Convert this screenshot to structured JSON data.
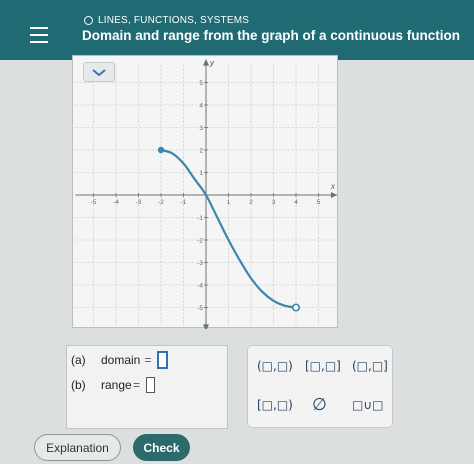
{
  "header": {
    "topic": "LINES, FUNCTIONS, SYSTEMS",
    "title": "Domain and range from the graph of a continuous function"
  },
  "graph": {
    "y_label": "y",
    "x_label": "x",
    "x_ticks": [
      "-5",
      "-4",
      "-3",
      "-2",
      "-1",
      "1",
      "2",
      "3",
      "4",
      "5"
    ],
    "y_ticks": [
      "5",
      "4",
      "3",
      "2",
      "1",
      "-1",
      "-2",
      "-3",
      "-4",
      "-5"
    ],
    "start_point": {
      "x": -2,
      "y": 2,
      "closed": true
    },
    "end_point": {
      "x": 4,
      "y": -5,
      "closed": false
    }
  },
  "answers": {
    "domain": {
      "part": "(a)",
      "label": "domain",
      "eq": "="
    },
    "range": {
      "part": "(b)",
      "label": "range",
      "eq": "="
    }
  },
  "palette": {
    "open_open": "(□,□)",
    "closed_closed": "[□,□]",
    "open_closed": "(□,□]",
    "closed_open": "[□,□)",
    "empty_set": "∅",
    "union": "□∪□"
  },
  "footer": {
    "explanation": "Explanation",
    "check": "Check"
  },
  "colors": {
    "header": "#1f6a73",
    "curve": "#3a86ad",
    "check_button": "#2c6a6e"
  }
}
